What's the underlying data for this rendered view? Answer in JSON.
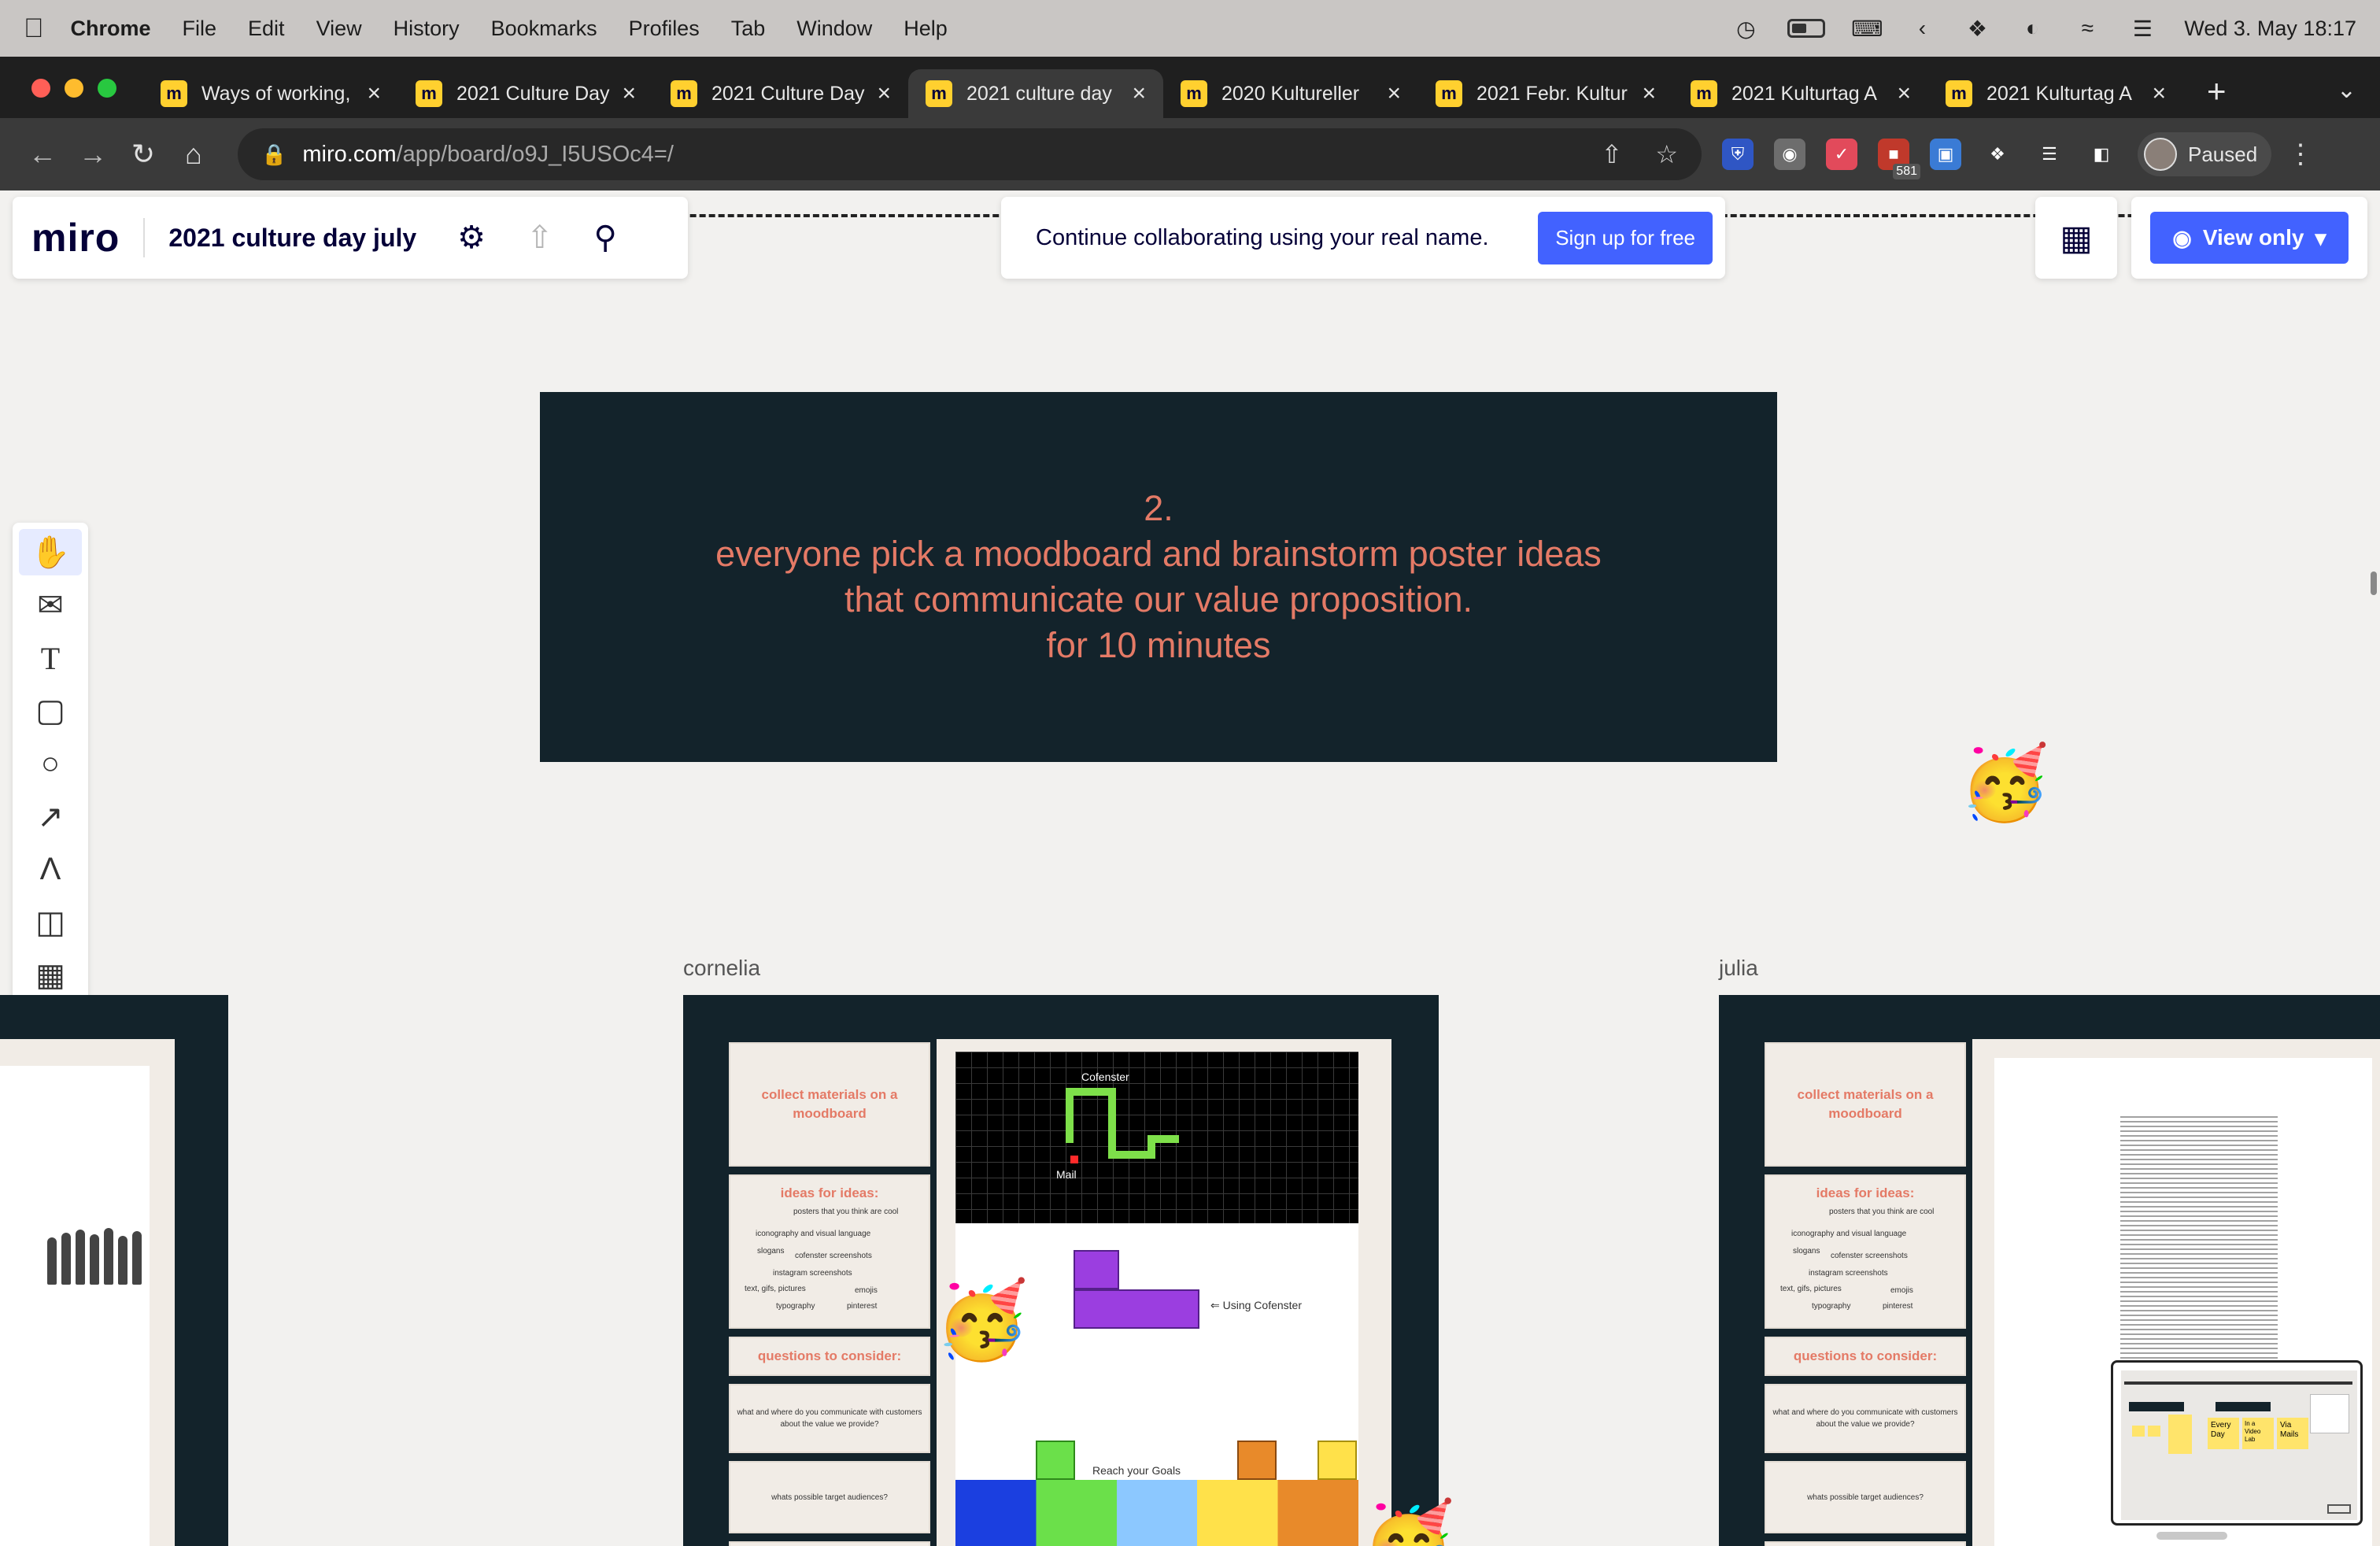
{
  "menubar": {
    "app": "Chrome",
    "items": [
      "File",
      "Edit",
      "View",
      "History",
      "Bookmarks",
      "Profiles",
      "Tab",
      "Window",
      "Help"
    ],
    "datetime": "Wed 3. May  18:17"
  },
  "tabs": [
    {
      "title": "Ways of working,",
      "active": false
    },
    {
      "title": "2021 Culture Day",
      "active": false
    },
    {
      "title": "2021 Culture Day",
      "active": false
    },
    {
      "title": "2021 culture day",
      "active": true
    },
    {
      "title": "2020 Kultureller",
      "active": false
    },
    {
      "title": "2021 Febr. Kultur",
      "active": false
    },
    {
      "title": "2021 Kulturtag A",
      "active": false
    },
    {
      "title": "2021 Kulturtag A",
      "active": false
    }
  ],
  "toolbar": {
    "url_host": "miro.com",
    "url_path": "/app/board/o9J_I5USOc4=/",
    "badge_count": "581",
    "profile_label": "Paused"
  },
  "miro": {
    "logo": "miro",
    "board_name": "2021 culture day july",
    "collab_message": "Continue collaborating using your real name.",
    "signup_label": "Sign up for free",
    "view_label": "View only"
  },
  "banner": {
    "line1": "2.",
    "line2": "everyone pick a moodboard and brainstorm poster ideas",
    "line3": "that communicate our value proposition.",
    "line4": "for 10 minutes"
  },
  "frames": {
    "left_name": "cornelia",
    "right_name": "julia"
  },
  "cards": {
    "collect": "collect materials on a moodboard",
    "ideas_title": "ideas for ideas:",
    "ideas_items": [
      "posters that you think are cool",
      "iconography and visual language",
      "slogans",
      "cofenster screenshots",
      "instagram screenshots",
      "text, gifs, pictures",
      "emojis",
      "typography",
      "pinterest"
    ],
    "questions_title": "questions to consider:",
    "q1": "what and where do you communicate with customers about the value we provide?",
    "q2": "whats possible target audiences?"
  },
  "tetris": {
    "label_top": "Cofenster",
    "label_mail": "Mail",
    "label_using": "Using Cofenster",
    "label_goals": "Reach your Goals"
  },
  "minimap": {
    "card1": "Every Day",
    "card2": "In a Video Lab",
    "card3": "Via Mails"
  },
  "colors": {
    "accent": "#4262ff",
    "banner_bg": "#13232b",
    "banner_text": "#e47a66"
  }
}
